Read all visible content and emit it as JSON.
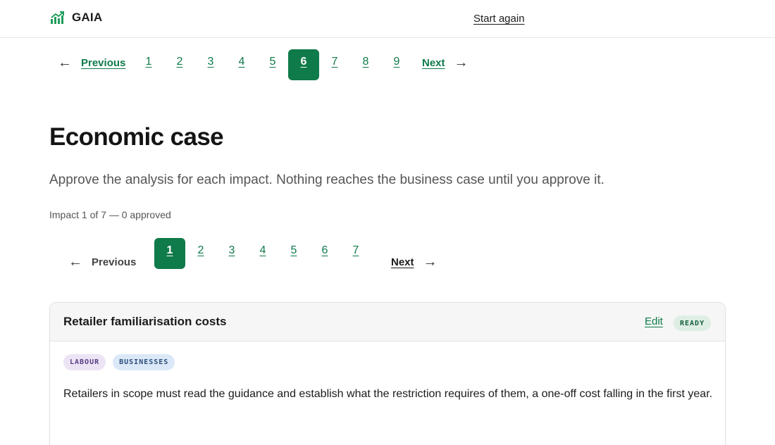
{
  "header": {
    "brand": "GAIA",
    "start_again": "Start again"
  },
  "section_pager": {
    "previous": "Previous",
    "next": "Next",
    "pages": [
      "1",
      "2",
      "3",
      "4",
      "5",
      "6",
      "7",
      "8",
      "9"
    ],
    "current": "6"
  },
  "page": {
    "title": "Economic case",
    "lead": "Approve the analysis for each impact. Nothing reaches the business case until you approve it.",
    "meta": "Impact 1 of 7 — 0 approved"
  },
  "impact_pager": {
    "previous": "Previous",
    "next": "Next",
    "pages": [
      "1",
      "2",
      "3",
      "4",
      "5",
      "6",
      "7"
    ],
    "current": "1"
  },
  "card": {
    "title": "Retailer familiarisation costs",
    "edit": "Edit",
    "status": "READY",
    "tags": [
      "LABOUR",
      "BUSINESSES"
    ],
    "description": "Retailers in scope must read the guidance and establish what the restriction requires of them, a one-off cost falling in the first year."
  },
  "colors": {
    "accent": "#0f7a4a",
    "ready_bg": "#dfeee5",
    "labour_bg": "#ece4f5",
    "businesses_bg": "#dbe8f7"
  },
  "icons": {
    "logo": "bar-chart-trend-icon",
    "previous": "arrow-left-icon",
    "next": "arrow-right-icon"
  }
}
